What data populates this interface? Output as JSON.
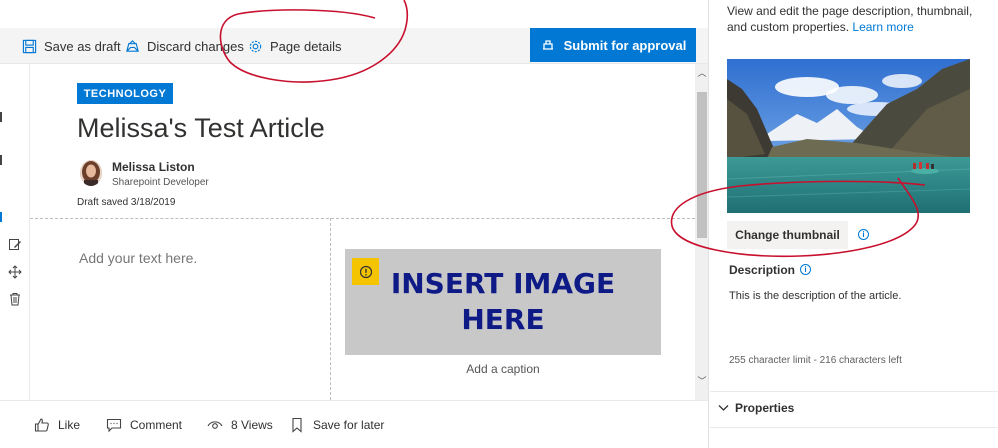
{
  "toolbar": {
    "save_draft": "Save as draft",
    "discard": "Discard changes",
    "page_details": "Page details",
    "submit": "Submit for approval"
  },
  "article": {
    "topic": "TECHNOLOGY",
    "title": "Melissa's Test Article",
    "author_name": "Melissa Liston",
    "author_role": "Sharepoint Developer",
    "draft_status": "Draft saved 3/18/2019",
    "text_placeholder": "Add your text here.",
    "image_placeholder_line1": "INSERT IMAGE",
    "image_placeholder_line2": "HERE",
    "caption_placeholder": "Add a caption"
  },
  "footer": {
    "like": "Like",
    "comment": "Comment",
    "views": "8 Views",
    "save_later": "Save for later"
  },
  "panel": {
    "intro_text": "View and edit the page description, thumbnail, and custom properties.",
    "learn_more": "Learn more",
    "change_thumbnail": "Change thumbnail",
    "description_label": "Description",
    "description_value": "This is the description of the article.",
    "char_limit": "255 character limit - 216 characters left",
    "properties_label": "Properties"
  },
  "colors": {
    "accent": "#0078d4",
    "annotation": "#c8102e",
    "placeholder_bg": "#c8c8c8",
    "warning": "#f4c400"
  }
}
